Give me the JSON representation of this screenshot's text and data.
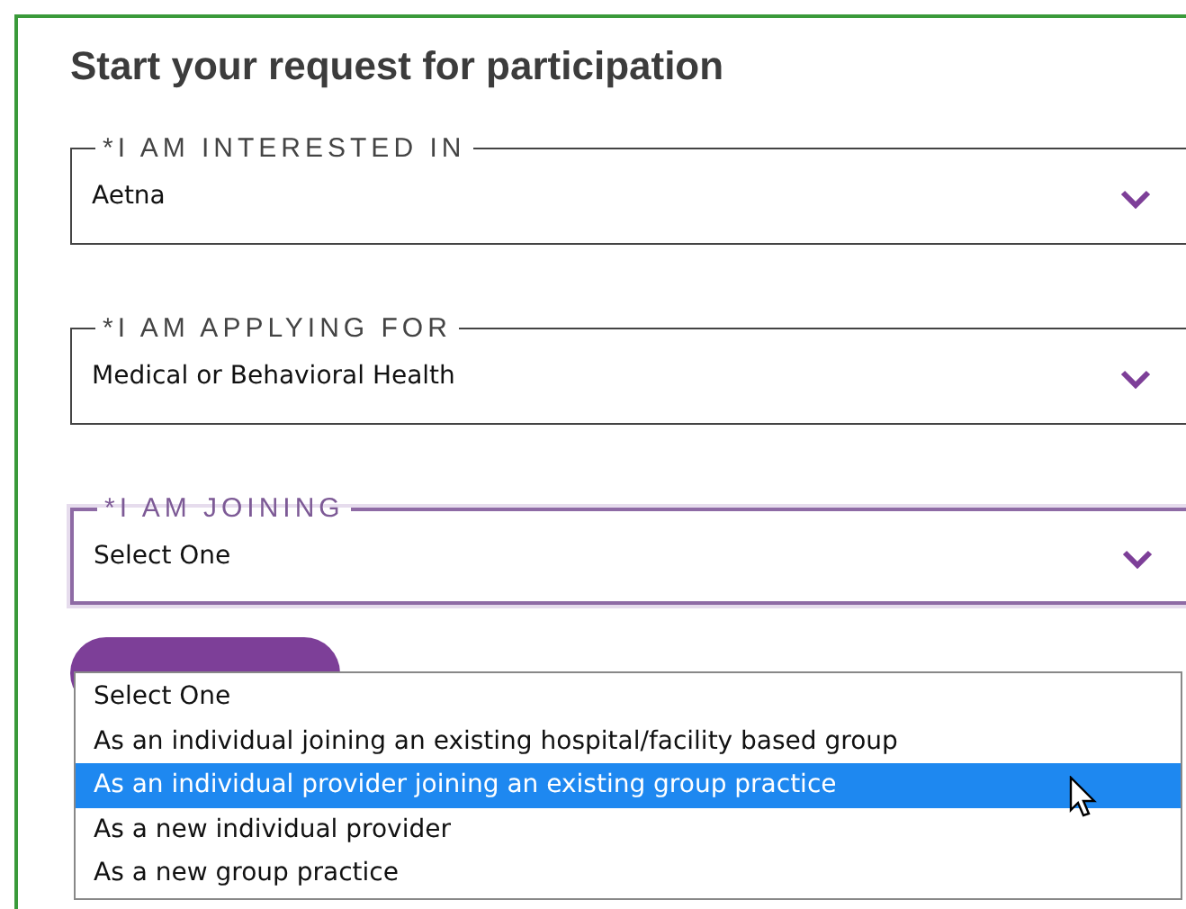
{
  "title": "Start your request for participation",
  "fields": [
    {
      "label": "*I AM INTERESTED IN",
      "value": "Aetna",
      "focused": false
    },
    {
      "label": "*I AM APPLYING FOR",
      "value": "Medical or Behavioral Health",
      "focused": false
    },
    {
      "label": "*I AM JOINING",
      "value": "Select One",
      "focused": true
    }
  ],
  "dropdown": {
    "options": [
      {
        "label": "Select One",
        "selected": false
      },
      {
        "label": "As an individual joining an existing hospital/facility based group",
        "selected": false
      },
      {
        "label": "As an individual provider joining an existing group practice",
        "selected": true
      },
      {
        "label": "As a new individual provider",
        "selected": false
      },
      {
        "label": "As a new group practice",
        "selected": false
      }
    ]
  }
}
